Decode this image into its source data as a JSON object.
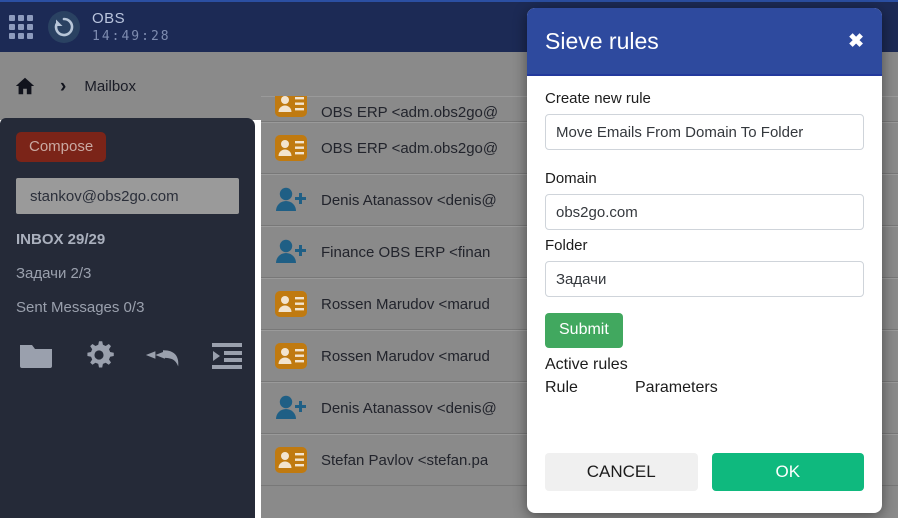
{
  "topnav": {
    "grid_icon": "apps-grid-icon",
    "logo_icon": "obs-refresh-logo-icon",
    "brand": "OBS",
    "clock": "14:49:28"
  },
  "breadcrumb": {
    "home_icon": "home-icon",
    "separator": "›",
    "current": "Mailbox"
  },
  "sidebar": {
    "compose_label": "Compose",
    "account": "stankov@obs2go.com",
    "folders": [
      {
        "label": "INBOX 29/29",
        "bold": true
      },
      {
        "label": "Задачи 2/3",
        "bold": false
      },
      {
        "label": "Sent Messages 0/3",
        "bold": false
      }
    ],
    "tools": [
      {
        "name": "folder-icon"
      },
      {
        "name": "gear-icon"
      },
      {
        "name": "reply-all-icon"
      },
      {
        "name": "indent-list-icon"
      }
    ]
  },
  "maillist": {
    "rows": [
      {
        "icon": "contact-card-icon",
        "text": "OBS ERP  <adm.obs2go@",
        "partial": true
      },
      {
        "icon": "contact-card-icon",
        "text": "OBS ERP <adm.obs2go@",
        "partial": false
      },
      {
        "icon": "add-person-icon",
        "text": "Denis Atanassov <denis@",
        "partial": false
      },
      {
        "icon": "add-person-icon",
        "text": "Finance OBS ERP <finan",
        "partial": false
      },
      {
        "icon": "contact-card-icon",
        "text": "Rossen Marudov <marud",
        "partial": false
      },
      {
        "icon": "contact-card-icon",
        "text": "Rossen Marudov <marud",
        "partial": false
      },
      {
        "icon": "add-person-icon",
        "text": "Denis Atanassov <denis@",
        "partial": false
      },
      {
        "icon": "contact-card-icon",
        "text": "Stefan Pavlov <stefan.pa",
        "partial": false
      }
    ]
  },
  "modal": {
    "title": "Sieve rules",
    "close_icon": "close-icon",
    "create_label": "Create new rule",
    "rule_type_value": "Move Emails From Domain To Folder",
    "domain_label": "Domain",
    "domain_value": "obs2go.com",
    "folder_label": "Folder",
    "folder_value": "Задачи",
    "submit_label": "Submit",
    "active_rules_label": "Active rules",
    "table_headers": {
      "rule": "Rule",
      "parameters": "Parameters"
    },
    "cancel_label": "CANCEL",
    "ok_label": "OK"
  },
  "colors": {
    "topnav_bg": "#1c2a55",
    "overlay_gray": "#8a8a8a",
    "sidebar_bg": "#252a38",
    "compose_red": "#7b2418",
    "modal_header_blue": "#2e4a9e",
    "submit_green": "#41a85f",
    "ok_green": "#0fb97e",
    "icon_orange": "#c07a10",
    "icon_blue": "#1f5f85"
  }
}
